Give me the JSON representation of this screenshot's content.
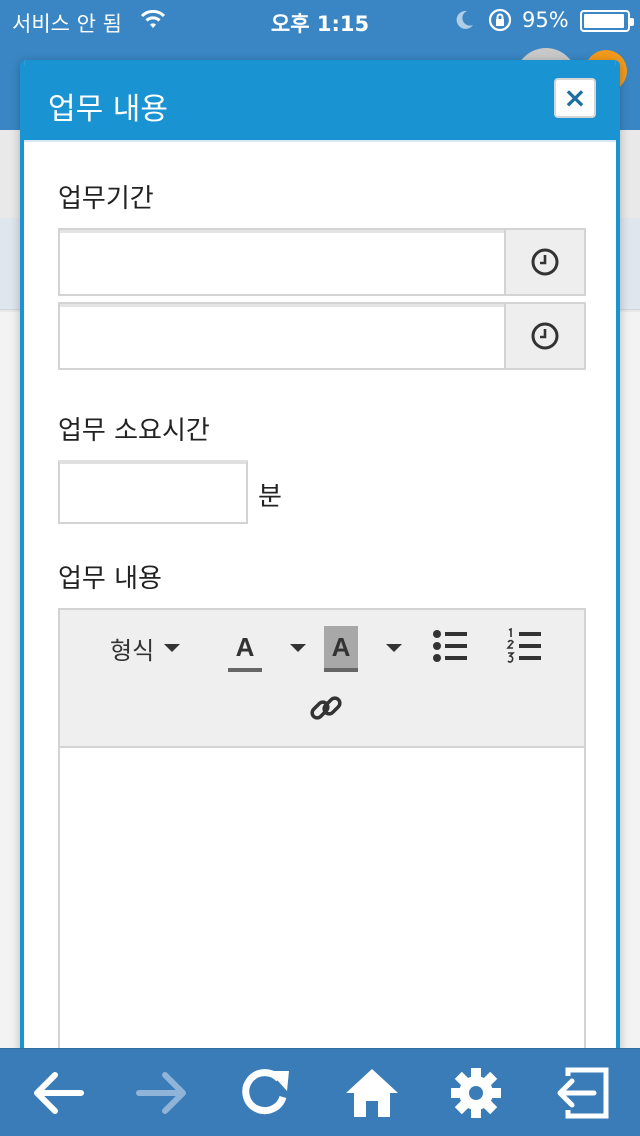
{
  "status_bar": {
    "carrier": "서비스 안 됨",
    "time": "오후 1:15",
    "battery": "95%",
    "battery_level": 0.95,
    "icons": [
      "wifi-icon",
      "moon-icon",
      "rotation-lock-icon",
      "battery-icon"
    ]
  },
  "modal": {
    "title": "업무 내용",
    "close_label": "×"
  },
  "form": {
    "period_label": "업무기간",
    "start_value": "",
    "end_value": "",
    "duration_label": "업무 소요시간",
    "duration_value": "",
    "duration_unit": "분",
    "content_label": "업무 내용"
  },
  "editor": {
    "format_label": "형식",
    "text_color_label": "A",
    "bg_color_label": "A",
    "body": ""
  },
  "bottom_nav": {
    "icons": [
      "back-arrow-icon",
      "forward-arrow-icon",
      "refresh-icon",
      "home-icon",
      "gear-icon",
      "logout-icon"
    ]
  },
  "colors": {
    "header_blue": "#1a93d2",
    "bar_blue": "#3a7cb8",
    "badge_orange": "#f39a1c"
  }
}
